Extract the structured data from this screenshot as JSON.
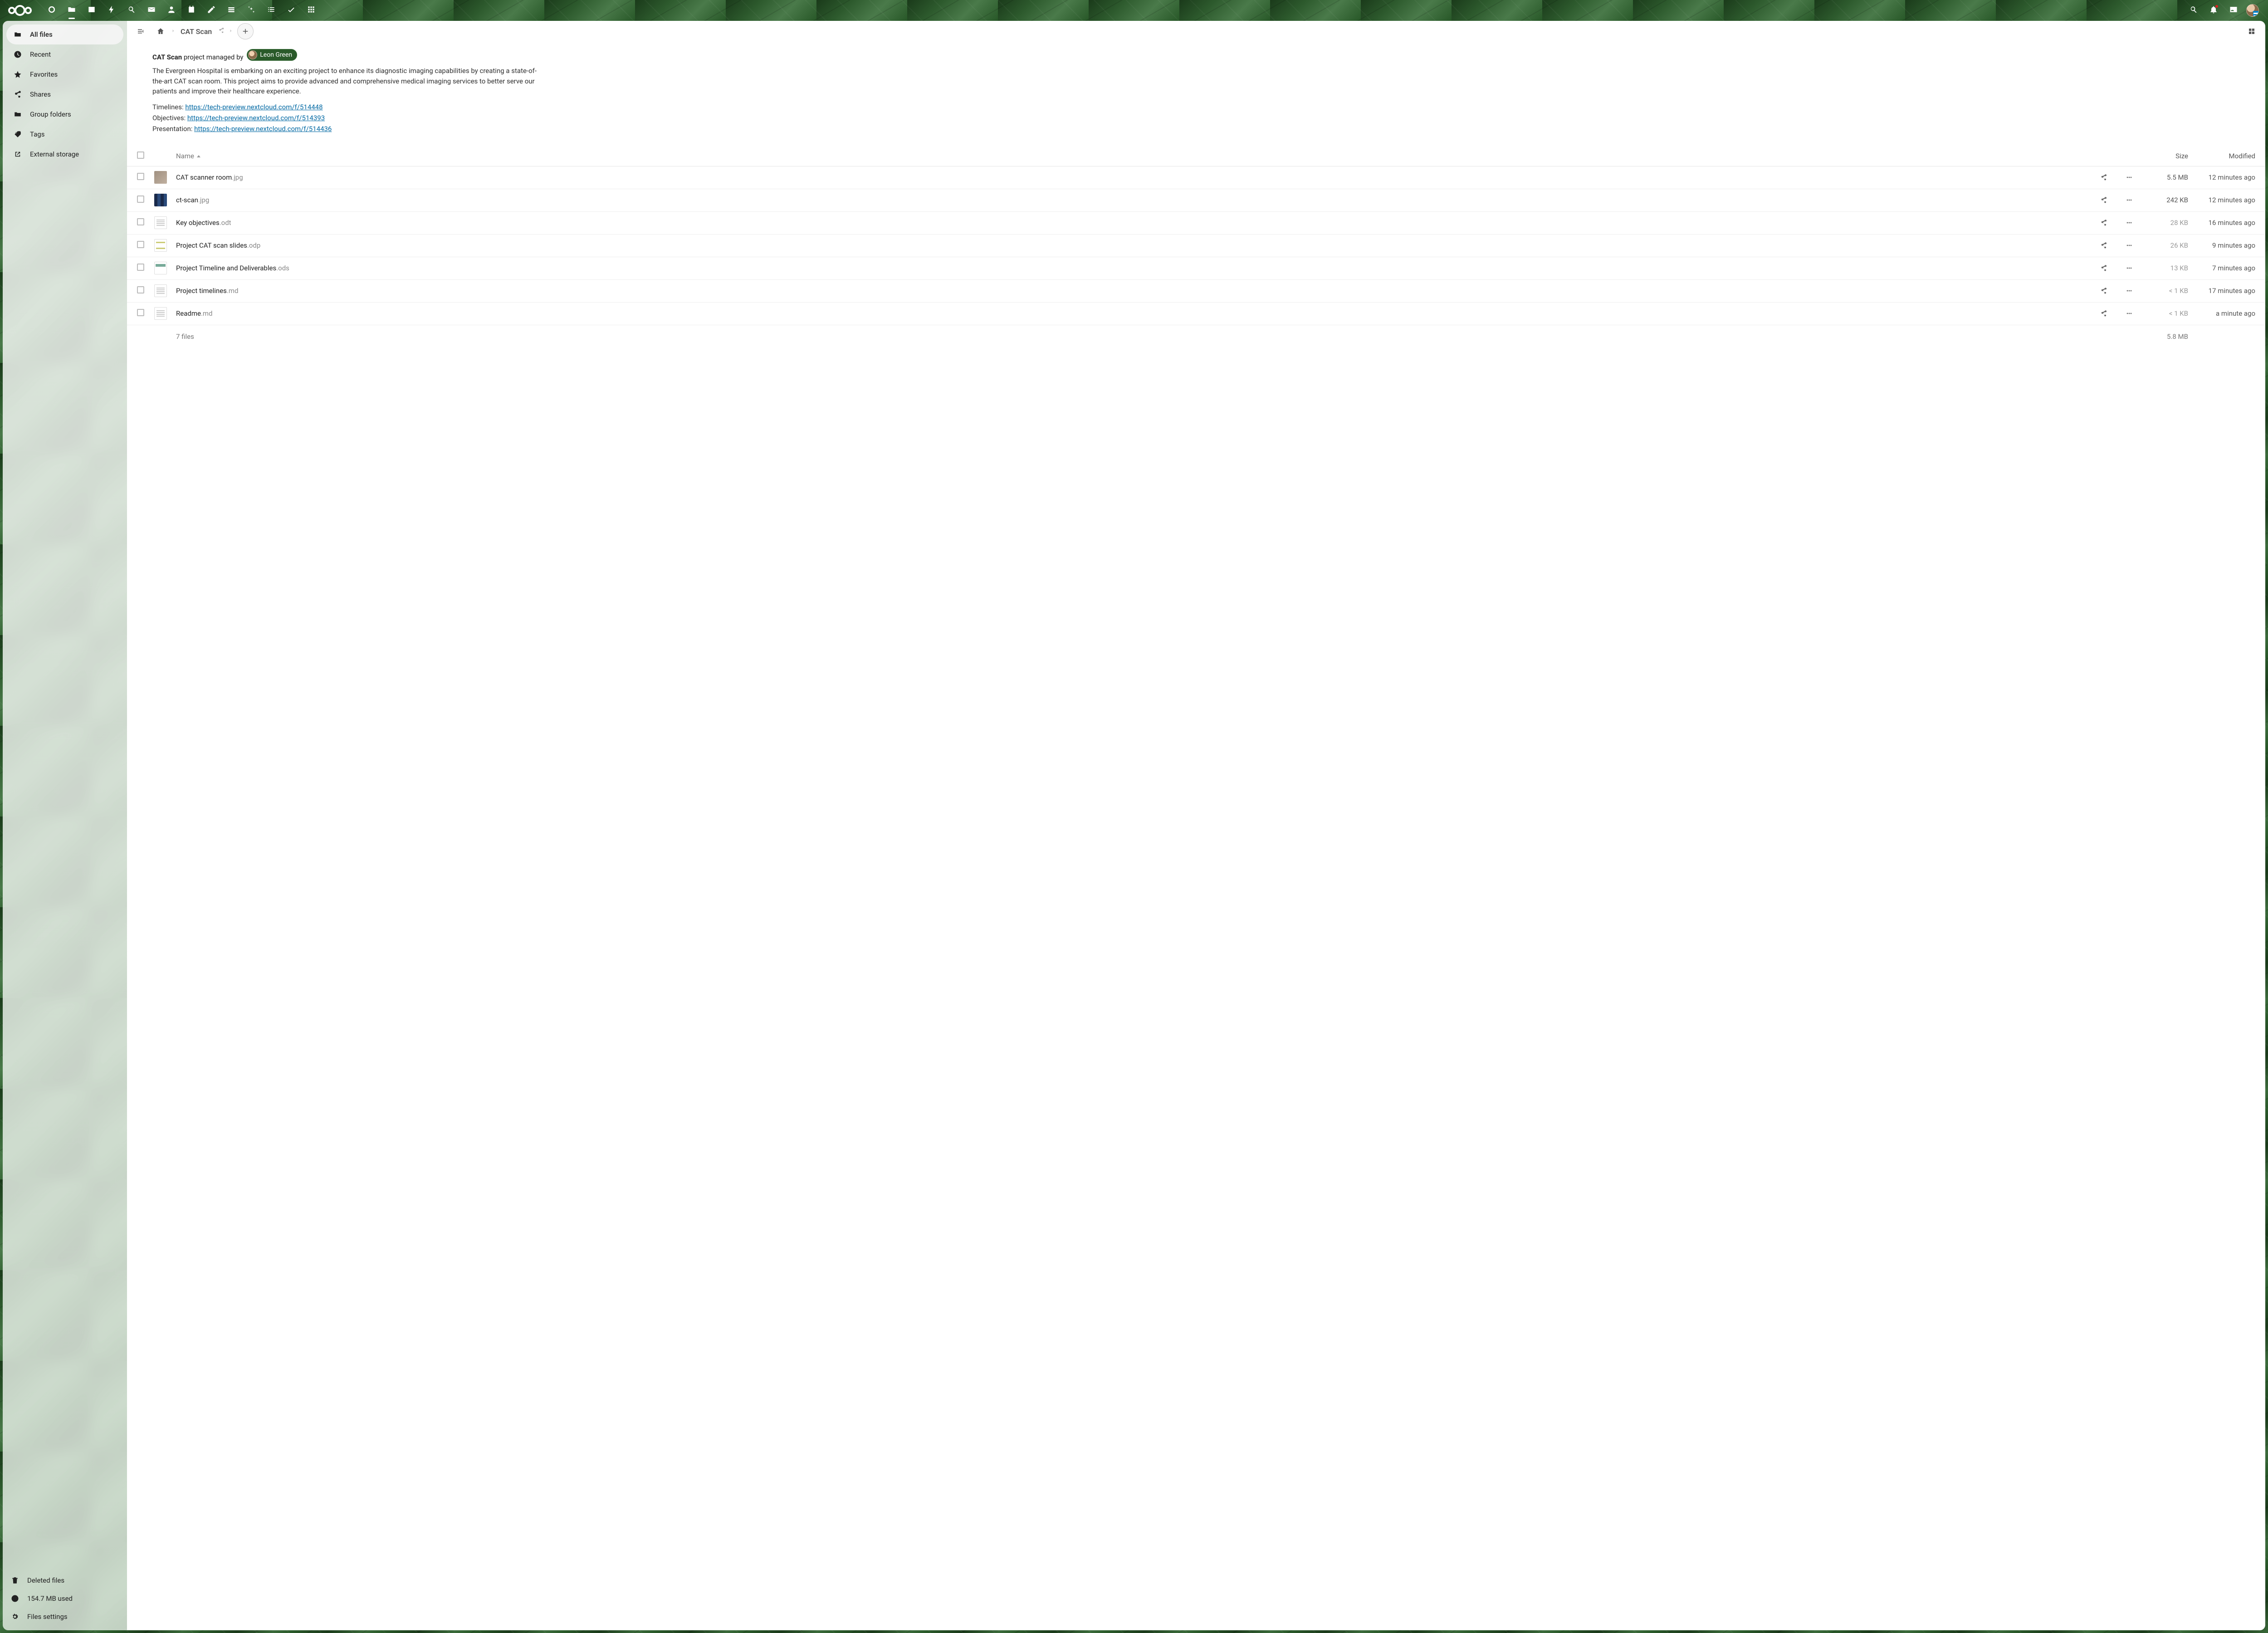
{
  "topbar": {
    "apps": [
      {
        "name": "dashboard",
        "icon": "circle-outline"
      },
      {
        "name": "files",
        "icon": "folder",
        "active": true
      },
      {
        "name": "photos",
        "icon": "image"
      },
      {
        "name": "activity",
        "icon": "bolt"
      },
      {
        "name": "search",
        "icon": "magnify"
      },
      {
        "name": "mail",
        "icon": "mail"
      },
      {
        "name": "contacts",
        "icon": "people"
      },
      {
        "name": "calendar",
        "icon": "calendar"
      },
      {
        "name": "notes",
        "icon": "pencil"
      },
      {
        "name": "deck",
        "icon": "stack"
      },
      {
        "name": "assist",
        "icon": "sparkle"
      },
      {
        "name": "lists",
        "icon": "list"
      },
      {
        "name": "tasks",
        "icon": "check"
      },
      {
        "name": "tables",
        "icon": "grid"
      }
    ],
    "tray": [
      {
        "name": "unified-search",
        "icon": "magnify"
      },
      {
        "name": "notifications",
        "icon": "bell",
        "badge": true
      },
      {
        "name": "contacts-menu",
        "icon": "id-card"
      }
    ]
  },
  "sidebar": {
    "items": [
      {
        "icon": "folder-solid",
        "label": "All files",
        "active": true
      },
      {
        "icon": "clock",
        "label": "Recent"
      },
      {
        "icon": "star",
        "label": "Favorites"
      },
      {
        "icon": "share",
        "label": "Shares"
      },
      {
        "icon": "folder-group",
        "label": "Group folders"
      },
      {
        "icon": "tag",
        "label": "Tags"
      },
      {
        "icon": "external",
        "label": "External storage"
      }
    ],
    "footer": {
      "deleted": "Deleted files",
      "quota": "154.7 MB used",
      "settings": "Files settings"
    }
  },
  "breadcrumb": {
    "current": "CAT Scan"
  },
  "description": {
    "title_bold": "CAT Scan",
    "title_rest": " project managed by ",
    "owner": "Leon Green",
    "body": "The Evergreen Hospital is embarking on an exciting project to enhance its diagnostic imaging capabilities by creating a state-of-the-art CAT scan room. This project aims to provide advanced and comprehensive medical imaging services to better serve our patients and improve their healthcare experience.",
    "links": [
      {
        "label": "Timelines: ",
        "url": "https://tech-preview.nextcloud.com/f/514448"
      },
      {
        "label": "Objectives: ",
        "url": "https://tech-preview.nextcloud.com/f/514393"
      },
      {
        "label": "Presentation: ",
        "url": "https://tech-preview.nextcloud.com/f/514436"
      }
    ]
  },
  "table": {
    "headers": {
      "name": "Name",
      "size": "Size",
      "modified": "Modified"
    },
    "rows": [
      {
        "thumb": "img1",
        "base": "CAT scanner room",
        "ext": ".jpg",
        "size": "5.5 MB",
        "size_dim": false,
        "modified": "12 minutes ago"
      },
      {
        "thumb": "img2",
        "base": "ct-scan",
        "ext": ".jpg",
        "size": "242 KB",
        "size_dim": false,
        "modified": "12 minutes ago"
      },
      {
        "thumb": "doc",
        "base": "Key objectives",
        "ext": ".odt",
        "size": "28 KB",
        "size_dim": true,
        "modified": "16 minutes ago"
      },
      {
        "thumb": "slides",
        "base": "Project CAT scan slides",
        "ext": ".odp",
        "size": "26 KB",
        "size_dim": true,
        "modified": "9 minutes ago"
      },
      {
        "thumb": "sheet",
        "base": "Project Timeline and Deliverables",
        "ext": ".ods",
        "size": "13 KB",
        "size_dim": true,
        "modified": "7 minutes ago"
      },
      {
        "thumb": "doc",
        "base": "Project timelines",
        "ext": ".md",
        "size": "< 1 KB",
        "size_dim": true,
        "modified": "17 minutes ago"
      },
      {
        "thumb": "doc",
        "base": "Readme",
        "ext": ".md",
        "size": "< 1 KB",
        "size_dim": true,
        "modified": "a minute ago"
      }
    ],
    "summary": {
      "count": "7 files",
      "size": "5.8 MB"
    }
  }
}
